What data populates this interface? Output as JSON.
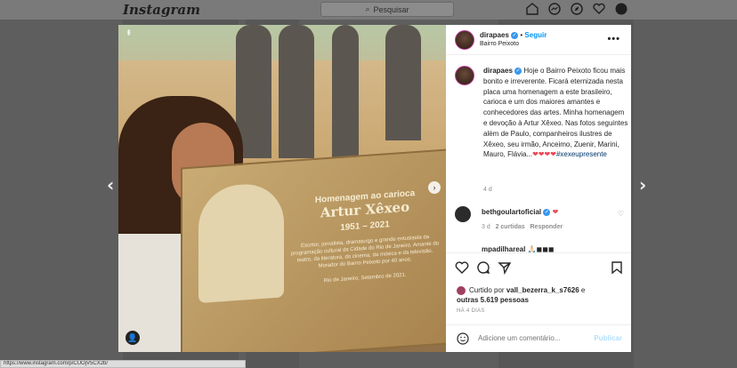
{
  "app": {
    "logo": "Instagram"
  },
  "nav": {
    "search_placeholder": "Pesquisar"
  },
  "post": {
    "username": "dirapaes",
    "follow_label": "Seguir",
    "location": "Bairro Peixoto",
    "caption_text": "Hoje o Bairro Peixoto ficou mais bonito e irreverente. Ficará eternizada nesta placa uma homenagem a este brasileiro, carioca e um dos maiores amantes e conhecedores das artes. Minha homenagem e devoção à Artur Xêxeo. Nas fotos seguintes além de Paulo, companheiros ilustres de Xêxeo, seu irmão, Anceimo, Zuenir, Marini, Mauro, Flávia...",
    "hearts": "❤❤❤❤",
    "hashtag": "#xexeupresente",
    "caption_time": "4 d",
    "comments": [
      {
        "user": "bethgoulartoficial",
        "text": "❤",
        "time": "3 d",
        "likes": "2 curtidas",
        "reply": "Responder"
      },
      {
        "user": "mpadilhareal",
        "text": "🙏🏻◼◼◼"
      }
    ],
    "liked_by_prefix": "Curtido por",
    "liked_by_user": "vall_bezerra_k_s7626",
    "liked_by_mid": "e",
    "liked_by_others": "outras 5.619 pessoas",
    "ago": "HÁ 4 DIAS",
    "comment_placeholder": "Adicione um comentário...",
    "publish_label": "Publicar"
  },
  "plaque": {
    "line1": "Homenagem ao carioca",
    "line2": "Artur Xêxeo",
    "line3": "1951 – 2021",
    "body": "Escritor, jornalista, dramaturgo e grande entusiasta da programação cultural da Cidade do Rio de Janeiro. Amante do teatro, da literatura, do cinema, da música e da televisão. Morador do Bairro Peixoto por 40 anos.",
    "footer": "Rio de Janeiro, Setembro de 2021."
  },
  "status_bar": {
    "url": "https://www.instagram.com/p/CUOjV5CX2b/"
  },
  "colors": {
    "link": "#0095f6",
    "heart": "#ed4956",
    "verified": "#3897f0"
  }
}
